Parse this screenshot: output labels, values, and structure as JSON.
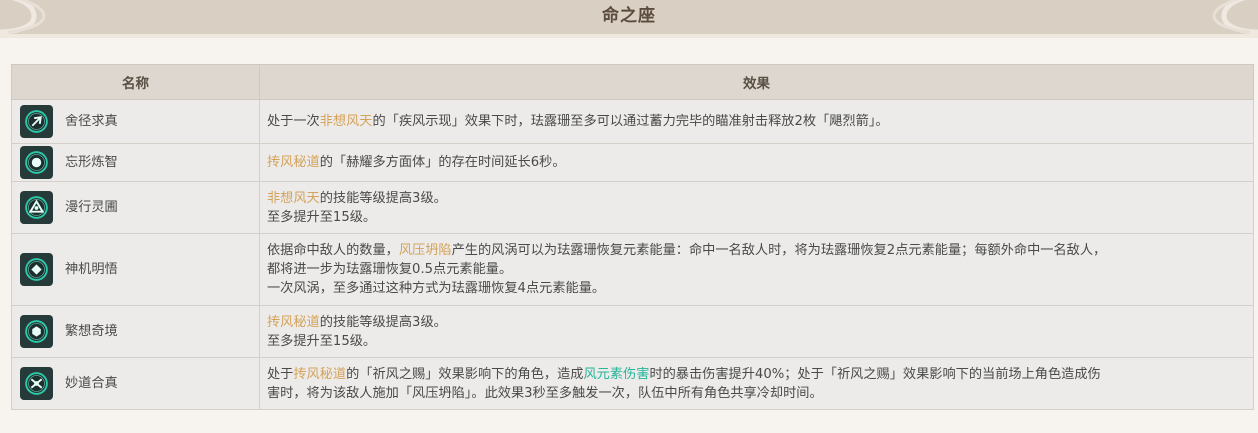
{
  "header": {
    "title": "命之座"
  },
  "table": {
    "columns": [
      "名称",
      "效果"
    ],
    "rows": [
      {
        "name": "舍径求真",
        "icon": "constellation-1-icon",
        "lines": [
          [
            {
              "t": "处于一次"
            },
            {
              "t": "非想风天",
              "hl": "gold"
            },
            {
              "t": "的「疾风示现」效果下时，珐露珊至多可以通过蓄力完毕的瞄准射击释放2枚「飓烈箭」。"
            }
          ]
        ]
      },
      {
        "name": "忘形炼智",
        "icon": "constellation-2-icon",
        "lines": [
          [
            {
              "t": "抟风秘道",
              "hl": "gold"
            },
            {
              "t": "的「赫耀多方面体」的存在时间延长6秒。"
            }
          ]
        ]
      },
      {
        "name": "漫行灵圃",
        "icon": "constellation-3-icon",
        "lines": [
          [
            {
              "t": "非想风天",
              "hl": "gold"
            },
            {
              "t": "的技能等级提高3级。"
            }
          ],
          [
            {
              "t": "至多提升至15级。"
            }
          ]
        ]
      },
      {
        "name": "神机明悟",
        "icon": "constellation-4-icon",
        "lines": [
          [
            {
              "t": "依据命中敌人的数量，"
            },
            {
              "t": "风压坍陷",
              "hl": "gold"
            },
            {
              "t": "产生的风涡可以为珐露珊恢复元素能量：命中一名敌人时，将为珐露珊恢复2点元素能量；每额外命中一名敌人，"
            }
          ],
          [
            {
              "t": "都将进一步为珐露珊恢复0.5点元素能量。"
            }
          ],
          [
            {
              "t": "一次风涡，至多通过这种方式为珐露珊恢复4点元素能量。"
            }
          ]
        ]
      },
      {
        "name": "繁想奇境",
        "icon": "constellation-5-icon",
        "lines": [
          [
            {
              "t": "抟风秘道",
              "hl": "gold"
            },
            {
              "t": "的技能等级提高3级。"
            }
          ],
          [
            {
              "t": "至多提升至15级。"
            }
          ]
        ]
      },
      {
        "name": "妙道合真",
        "icon": "constellation-6-icon",
        "lines": [
          [
            {
              "t": "处于"
            },
            {
              "t": "抟风秘道",
              "hl": "gold"
            },
            {
              "t": "的「祈风之赐」效果影响下的角色，造成"
            },
            {
              "t": "风元素伤害",
              "hl": "green"
            },
            {
              "t": "时的暴击伤害提升40%；处于「祈风之赐」效果影响下的当前场上角色造成伤"
            }
          ],
          [
            {
              "t": "害时，将为该敌人施加「风压坍陷」。此效果3秒至多触发一次，队伍中所有角色共享冷却时间。"
            }
          ]
        ]
      }
    ]
  },
  "colors": {
    "banner": "#d9cfc3",
    "title": "#5b4c3e",
    "header_bg": "#ddd7cf",
    "cell_bg": "#ecebe9",
    "gold": "#d4a35b",
    "green": "#27b59a",
    "icon_bg": "#263a3a",
    "icon_ring": "#2fc8a8"
  }
}
